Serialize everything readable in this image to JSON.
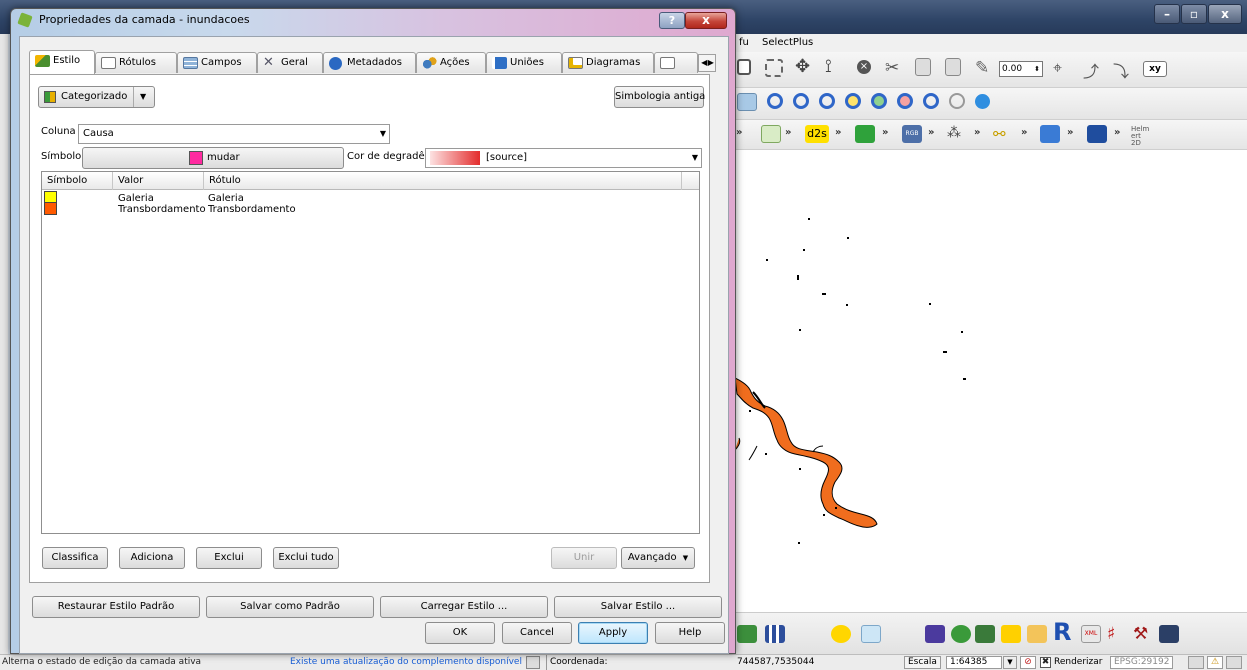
{
  "dialog": {
    "title": "Propriedades da camada - inundacoes",
    "help_glyph": "?",
    "close_glyph": "x",
    "tabs": [
      {
        "label": "Estilo",
        "icon": "paintbrush-icon"
      },
      {
        "label": "Rótulos",
        "icon": "label-icon"
      },
      {
        "label": "Campos",
        "icon": "table-icon"
      },
      {
        "label": "Geral",
        "icon": "tools-icon"
      },
      {
        "label": "Metadados",
        "icon": "info-icon"
      },
      {
        "label": "Ações",
        "icon": "gears-icon"
      },
      {
        "label": "Uniões",
        "icon": "join-icon"
      },
      {
        "label": "Diagramas",
        "icon": "chart-icon"
      }
    ],
    "tab_scroll": "◀ ▶",
    "renderer": "Categorizado",
    "old_symbology": "Simbologia antiga",
    "column_label": "Coluna",
    "column_value": "Causa",
    "symbol_label": "Símbolo",
    "symbol_change": "mudar",
    "color_ramp_label": "Cor de degradê",
    "color_ramp_value": "[source]",
    "table_headers": [
      "Símbolo",
      "Valor",
      "Rótulo"
    ],
    "categories": [
      {
        "value": "Galeria",
        "label": "Galeria",
        "color": "#ffff00"
      },
      {
        "value": "Transbordamento",
        "label": "Transbordamento",
        "color": "#ff5a00"
      }
    ],
    "buttons": {
      "classify": "Classifica",
      "add": "Adiciona",
      "delete": "Exclui",
      "delete_all": "Exclui tudo",
      "join": "Unir",
      "advanced": "Avançado"
    },
    "style_buttons": {
      "restore": "Restaurar Estilo Padrão",
      "save_default": "Salvar como Padrão",
      "load": "Carregar Estilo ...",
      "save": "Salvar Estilo ..."
    },
    "footer": {
      "ok": "OK",
      "cancel": "Cancel",
      "apply": "Apply",
      "help": "Help"
    }
  },
  "background_window": {
    "menu_items": [
      "fu",
      "SelectPlus"
    ],
    "scale_box": "0.00",
    "toolbar_text": {
      "xy": "xy",
      "d2s": "d2s",
      "helm": "Helm ert 2D",
      "rgb": "RGB",
      "xml": "XML"
    }
  },
  "statusbar": {
    "left": "Alterna o estado de edição da camada ativa",
    "plugin_update": "Existe uma atualização do complemento disponível",
    "coord_label": "Coordenada:",
    "coord_value": "744587,7535044",
    "scale_label": "Escala",
    "scale_value": "1:64385",
    "render_label": "Renderizar",
    "crs": "EPSG:29192"
  },
  "colors": {
    "galeria": "#ffff00",
    "transbordamento": "#ff5a00",
    "symbol_pink": "#ff2aa0",
    "river": "#f06d1e",
    "link": "#1a5fd6"
  }
}
